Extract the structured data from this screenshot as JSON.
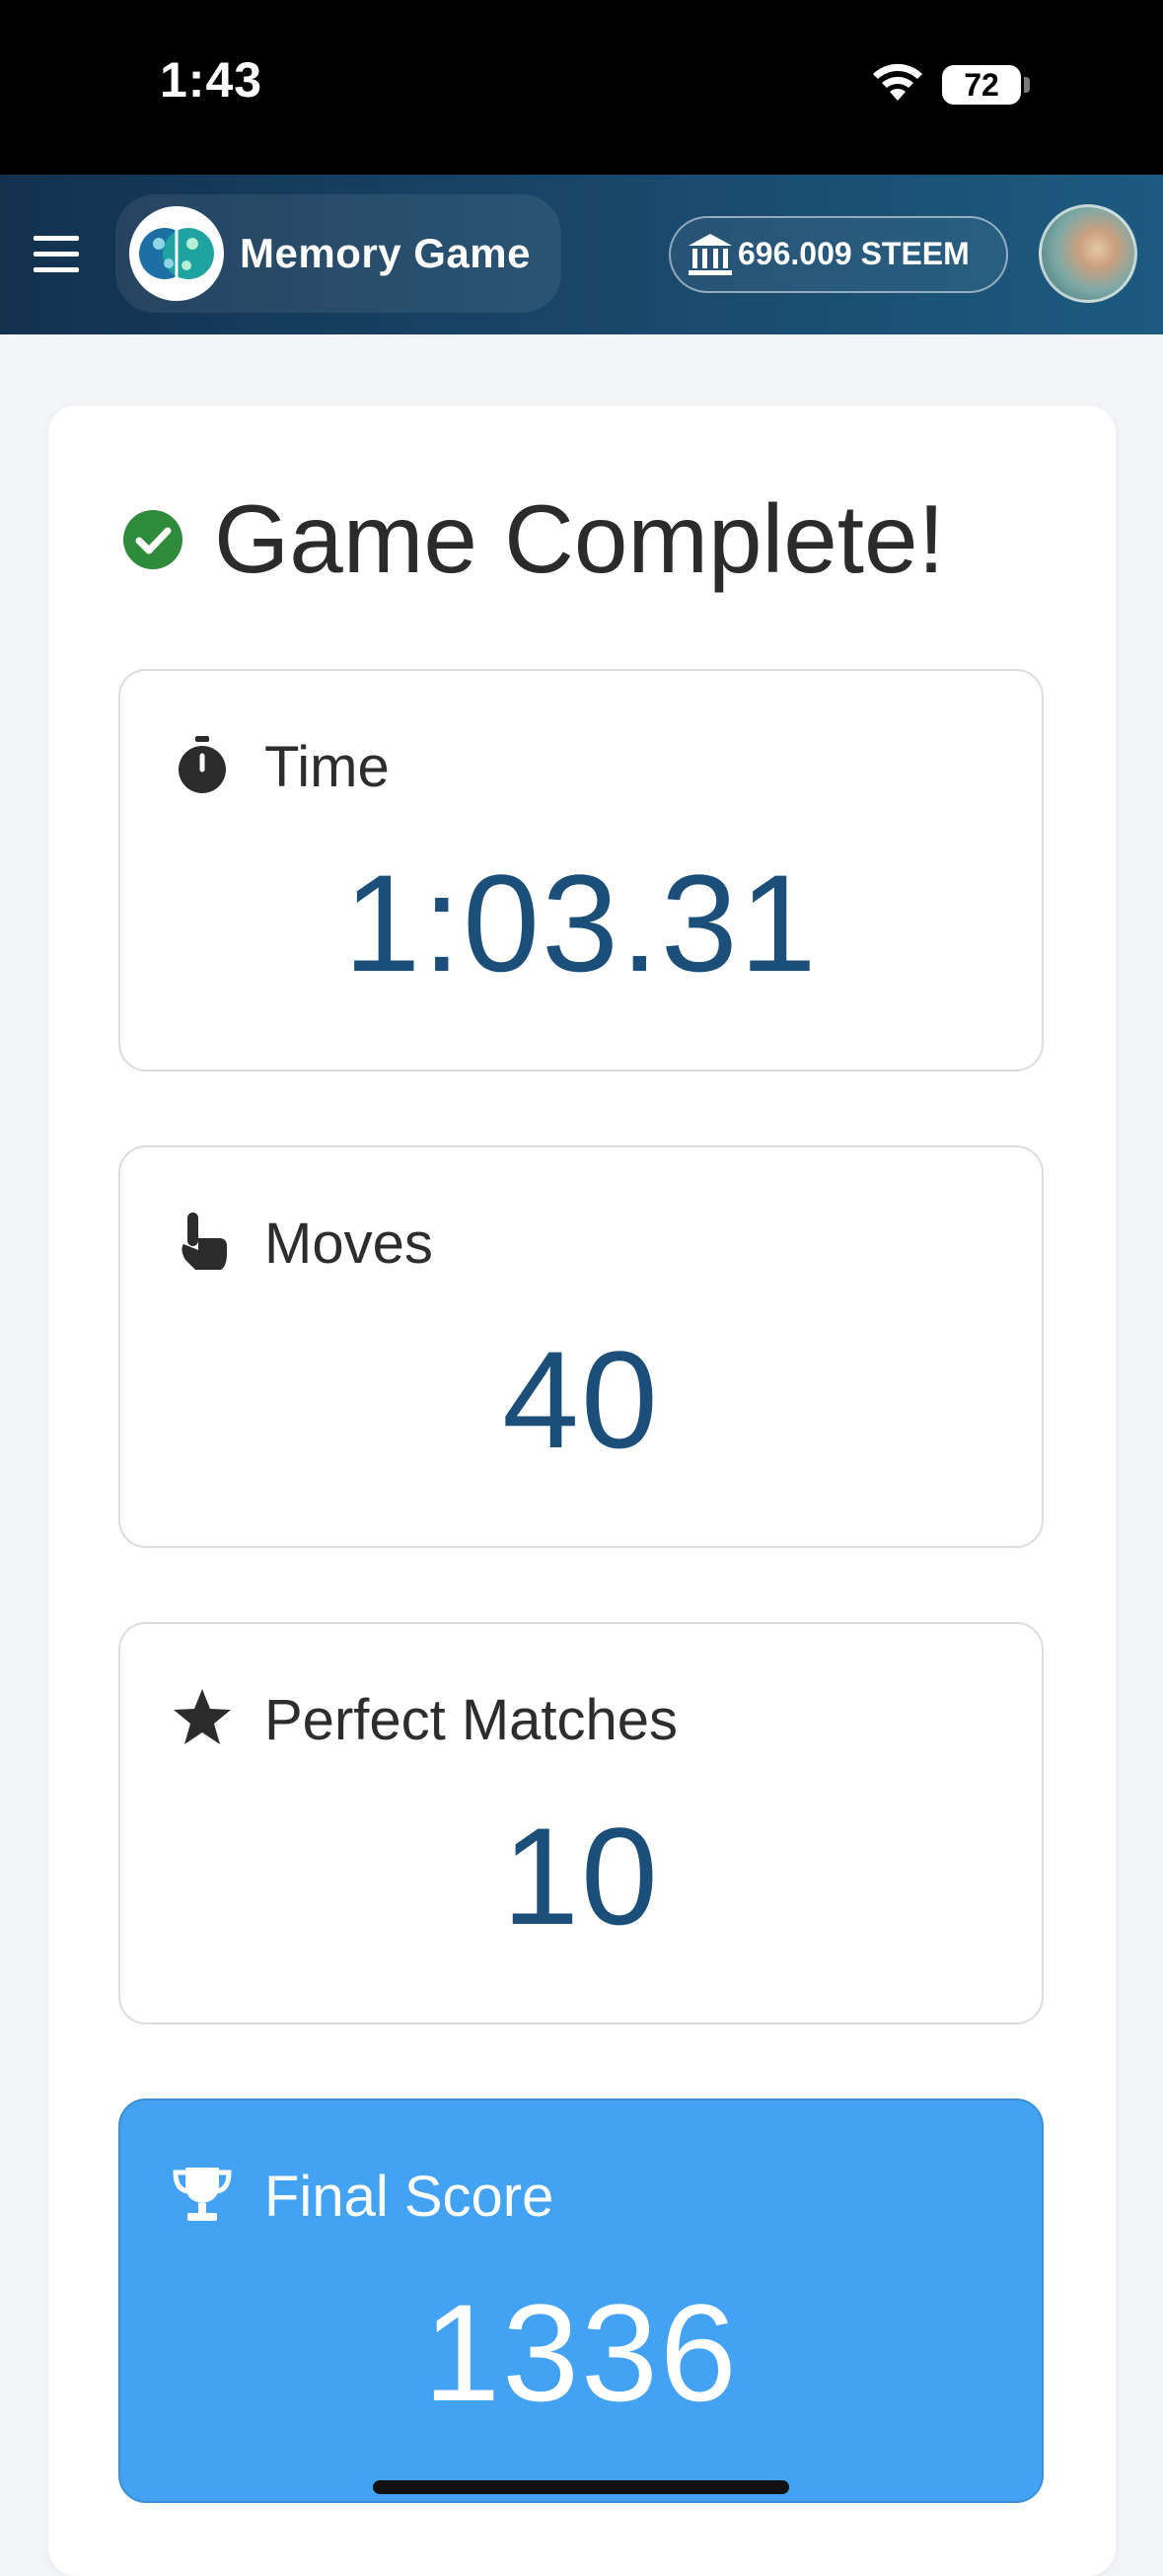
{
  "status_bar": {
    "time": "1:43",
    "battery": "72"
  },
  "header": {
    "app_title": "Memory Game",
    "balance": "696.009 STEEM",
    "colors": {
      "header_start": "#12314f",
      "header_end": "#1c5a80"
    }
  },
  "result": {
    "heading": "Game Complete!",
    "stats": {
      "time": {
        "label": "Time",
        "value": "1:03.31",
        "icon": "stopwatch-icon"
      },
      "moves": {
        "label": "Moves",
        "value": "40",
        "icon": "pointer-hand-icon"
      },
      "perfect": {
        "label": "Perfect Matches",
        "value": "10",
        "icon": "star-icon"
      },
      "score": {
        "label": "Final Score",
        "value": "1336",
        "icon": "trophy-icon"
      }
    },
    "colors": {
      "value_text": "#1b4f79",
      "score_background": "#43a2f1",
      "success_check": "#2e8b3c"
    }
  }
}
